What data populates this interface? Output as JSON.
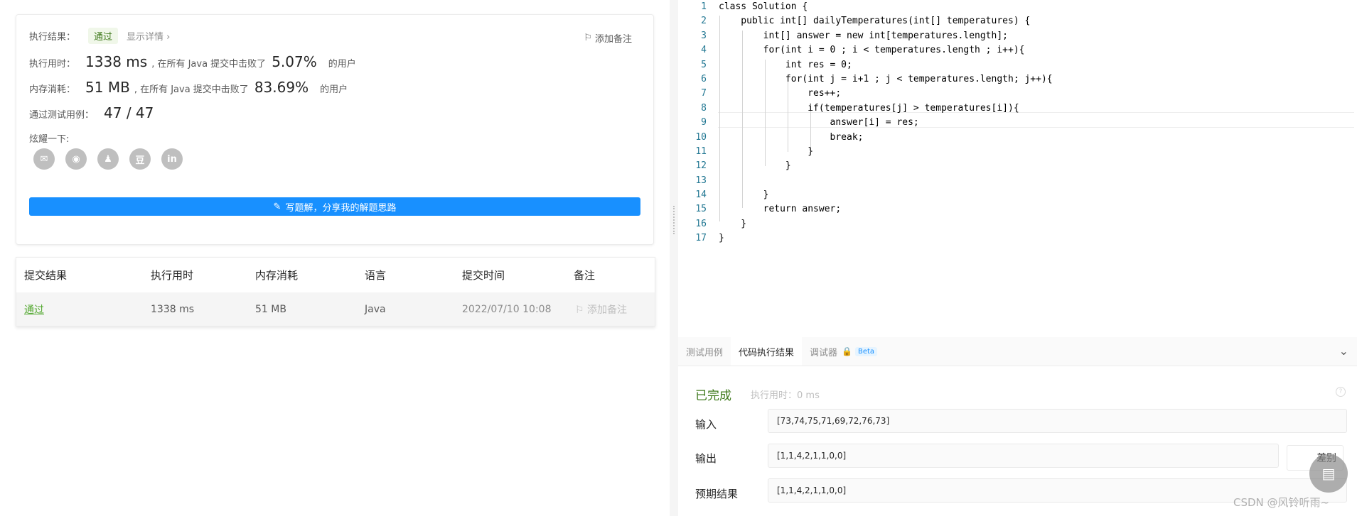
{
  "result_card": {
    "exec_result_label": "执行结果：",
    "status": "通过",
    "show_details": "显示详情 ›",
    "add_note": "添加备注",
    "runtime_label": "执行用时：",
    "runtime_value": "1338 ms",
    "runtime_mid": ", 在所有 Java 提交中击败了",
    "runtime_pct": "5.07%",
    "runtime_tail": "的用户",
    "memory_label": "内存消耗：",
    "memory_value": "51 MB",
    "memory_mid": ", 在所有 Java 提交中击败了",
    "memory_pct": "83.69%",
    "memory_tail": "的用户",
    "tests_label": "通过测试用例：",
    "tests_value": "47 / 47",
    "share_label": "炫耀一下:",
    "social_icons": [
      "wechat-icon",
      "weibo-icon",
      "qq-icon",
      "douban-icon",
      "linkedin-icon"
    ],
    "social_glyphs": [
      "✉",
      "◉",
      "♟",
      "豆",
      "in"
    ],
    "write_solution": "写题解，分享我的解题思路"
  },
  "submissions": {
    "headers": [
      "提交结果",
      "执行用时",
      "内存消耗",
      "语言",
      "提交时间",
      "备注"
    ],
    "row": {
      "result": "通过",
      "runtime": "1338 ms",
      "memory": "51 MB",
      "language": "Java",
      "time": "2022/07/10 10:08",
      "note": "添加备注"
    }
  },
  "code": {
    "lines": [
      "class Solution {",
      "    public int[] dailyTemperatures(int[] temperatures) {",
      "        int[] answer = new int[temperatures.length];",
      "        for(int i = 0 ; i < temperatures.length ; i++){",
      "            int res = 0;",
      "            for(int j = i+1 ; j < temperatures.length; j++){",
      "                res++;",
      "                if(temperatures[j] > temperatures[i]){",
      "                    answer[i] = res;",
      "                    break;",
      "                }",
      "            }",
      "",
      "        }",
      "        return answer;",
      "    }",
      "}"
    ]
  },
  "console": {
    "tabs": [
      "测试用例",
      "代码执行结果",
      "调试器"
    ],
    "beta": "Beta",
    "status": "已完成",
    "exec_time": "执行用时：0 ms",
    "input_label": "输入",
    "input_value": "[73,74,75,71,69,72,76,73]",
    "output_label": "输出",
    "output_value": "[1,1,4,2,1,1,0,0]",
    "diff_label": "差别",
    "expected_label": "预期结果",
    "expected_value": "[1,1,4,2,1,1,0,0]"
  },
  "watermark": "CSDN @风铃听雨~",
  "colors": {
    "accent": "#1890ff",
    "success": "#3f7a1c"
  }
}
